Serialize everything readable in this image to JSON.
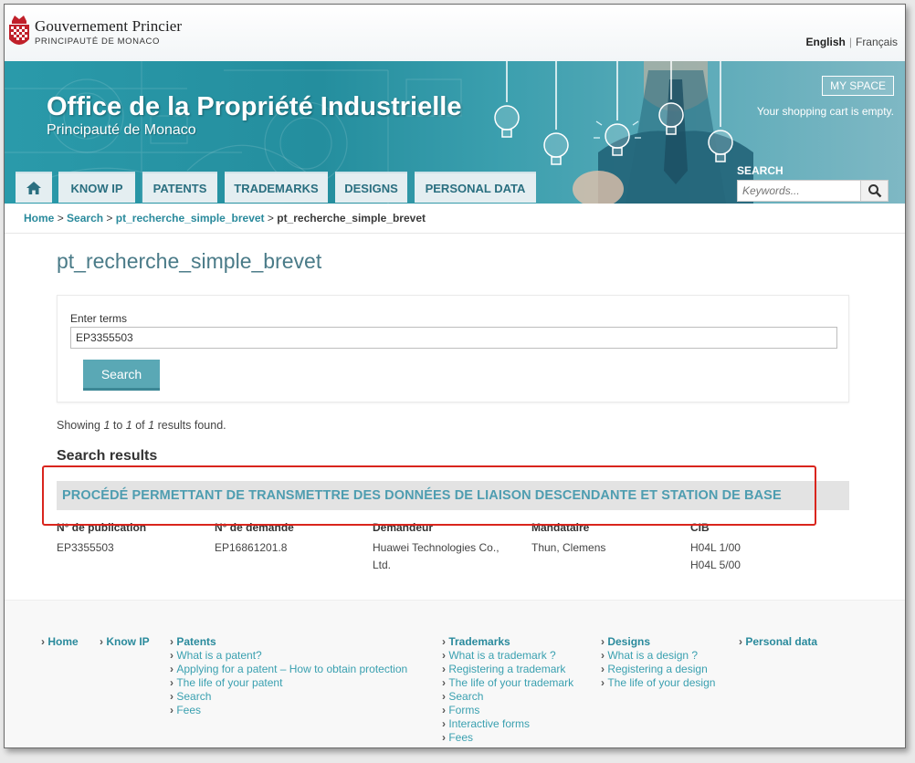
{
  "header": {
    "gov_name": "Gouvernement Princier",
    "gov_sub": "PRINCIPAUTÉ DE MONACO",
    "lang_en": "English",
    "lang_sep": "|",
    "lang_fr": "Français"
  },
  "banner": {
    "title": "Office de la Propriété Industrielle",
    "subtitle": "Principauté de Monaco",
    "my_space": "MY SPACE",
    "cart": "Your shopping cart is empty.",
    "search_label": "SEARCH",
    "search_placeholder": "Keywords..."
  },
  "nav": {
    "home_icon": "home-icon",
    "know_ip": "KNOW IP",
    "patents": "PATENTS",
    "trademarks": "TRADEMARKS",
    "designs": "DESIGNS",
    "personal_data": "PERSONAL DATA"
  },
  "breadcrumb": {
    "home": "Home",
    "search": "Search",
    "link3": "pt_recherche_simple_brevet",
    "current": "pt_recherche_simple_brevet",
    "sep": ">"
  },
  "main": {
    "page_title": "pt_recherche_simple_brevet",
    "terms_label": "Enter terms",
    "terms_value": "EP3355503",
    "search_button": "Search",
    "showing_prefix": "Showing",
    "showing_from": "1",
    "showing_to_word": "to",
    "showing_to": "1",
    "showing_of_word": "of",
    "showing_total": "1",
    "showing_suffix": "results found.",
    "results_heading": "Search results"
  },
  "result": {
    "title": "PROCÉDÉ PERMETTANT DE TRANSMETTRE DES DONNÉES DE LIAISON DESCENDANTE ET STATION DE BASE",
    "highlight_color": "#d9251d",
    "columns": [
      {
        "header": "N° de publication",
        "values": [
          "EP3355503"
        ]
      },
      {
        "header": "N° de demande",
        "values": [
          "EP16861201.8"
        ]
      },
      {
        "header": "Demandeur",
        "values": [
          "Huawei Technologies Co.,",
          "Ltd."
        ]
      },
      {
        "header": "Mandataire",
        "values": [
          "Thun, Clemens"
        ]
      },
      {
        "header": "CIB",
        "values": [
          "H04L 1/00",
          "H04L 5/00"
        ]
      }
    ]
  },
  "footer": {
    "home": "Home",
    "know_ip": "Know IP",
    "patents": {
      "heading": "Patents",
      "links": [
        "What is a patent?",
        "Applying for a patent – How to obtain protection",
        "The life of your patent",
        "Search",
        "Fees"
      ]
    },
    "trademarks": {
      "heading": "Trademarks",
      "links": [
        "What is a trademark ?",
        "Registering a trademark",
        "The life of your trademark",
        "Search",
        "Forms",
        "Interactive forms",
        "Fees"
      ]
    },
    "designs": {
      "heading": "Designs",
      "links": [
        "What is a design ?",
        "Registering a design",
        "The life of your design"
      ]
    },
    "personal_data": "Personal data"
  },
  "colors": {
    "banner_teal": "#2a9aaa",
    "link_teal": "#2a8a9c",
    "button_teal": "#5aa8b5"
  }
}
